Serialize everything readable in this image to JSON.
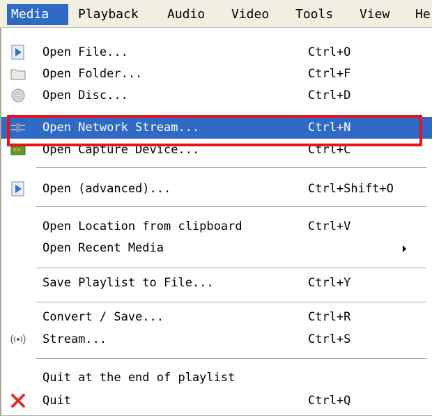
{
  "menubar": {
    "items": [
      {
        "label": "Media"
      },
      {
        "label": "Playback"
      },
      {
        "label": "Audio"
      },
      {
        "label": "Video"
      },
      {
        "label": "Tools"
      },
      {
        "label": "View"
      },
      {
        "label": "He"
      }
    ]
  },
  "menu": {
    "items": [
      {
        "label": "Open File...",
        "shortcut": "Ctrl+O",
        "icon": "file-play-icon"
      },
      {
        "label": "Open Folder...",
        "shortcut": "Ctrl+F",
        "icon": "folder-icon"
      },
      {
        "label": "Open Disc...",
        "shortcut": "Ctrl+D",
        "icon": "disc-icon"
      },
      {
        "label": "Open Network Stream...",
        "shortcut": "Ctrl+N",
        "icon": "network-icon"
      },
      {
        "label": "Open Capture Device...",
        "shortcut": "Ctrl+C",
        "icon": "capture-card-icon"
      },
      {
        "label": "Open (advanced)...",
        "shortcut": "Ctrl+Shift+O",
        "icon": "file-play-icon"
      },
      {
        "label": "Open Location from clipboard",
        "shortcut": "Ctrl+V"
      },
      {
        "label": "Open Recent Media",
        "shortcut": ""
      },
      {
        "label": "Save Playlist to File...",
        "shortcut": "Ctrl+Y"
      },
      {
        "label": "Convert / Save...",
        "shortcut": "Ctrl+R"
      },
      {
        "label": "Stream...",
        "shortcut": "Ctrl+S",
        "icon": "stream-icon"
      },
      {
        "label": "Quit at the end of playlist",
        "shortcut": ""
      },
      {
        "label": "Quit",
        "shortcut": "Ctrl+Q",
        "icon": "quit-x-icon"
      }
    ]
  },
  "colors": {
    "highlight": "#316ac5",
    "annotation_box": "#e3141b",
    "menubar_bg": "#f1efe2"
  }
}
